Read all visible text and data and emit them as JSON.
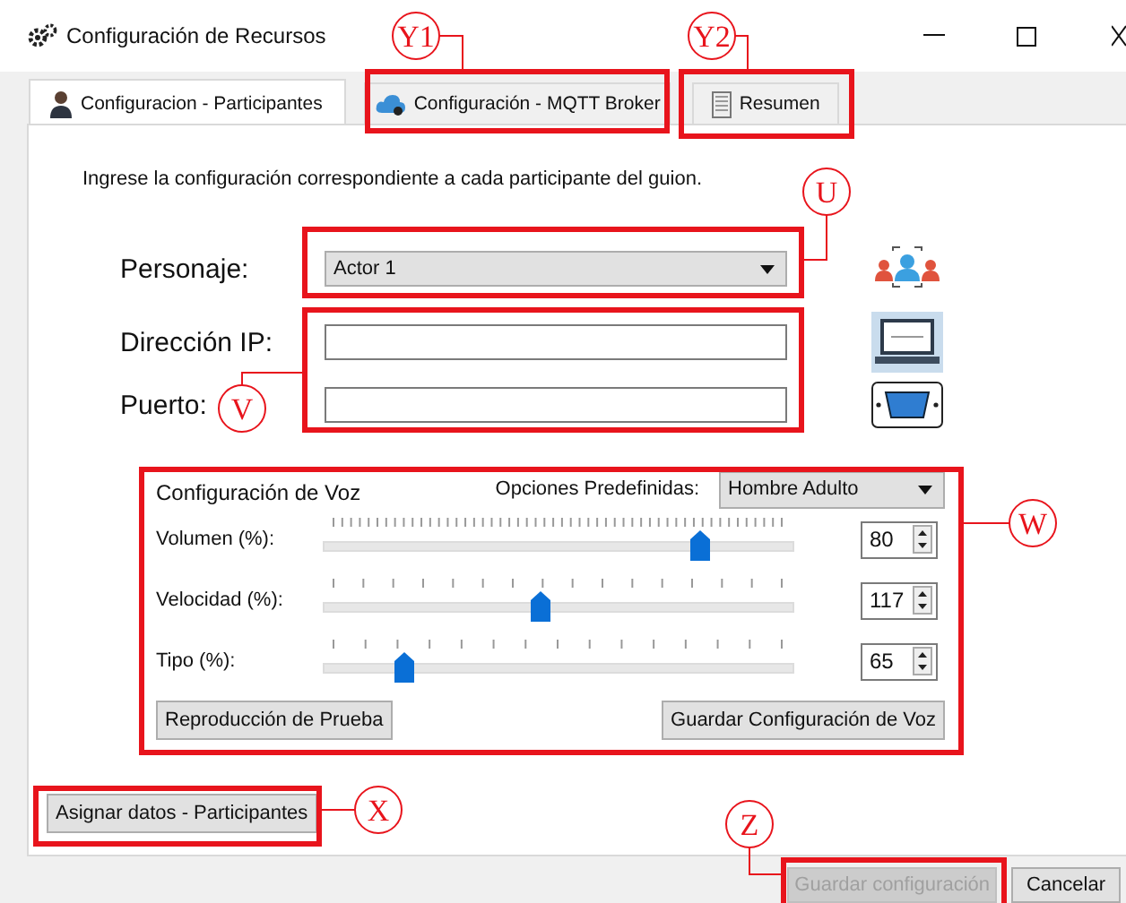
{
  "window": {
    "title": "Configuración de Recursos"
  },
  "tabs": [
    {
      "label": "Configuracion - Participantes",
      "selected": true
    },
    {
      "label": "Configuración - MQTT Broker",
      "selected": false
    },
    {
      "label": "Resumen",
      "selected": false
    }
  ],
  "instructions": "Ingrese la configuración correspondiente a cada participante del guion.",
  "personaje": {
    "label": "Personaje:",
    "value": "Actor 1"
  },
  "ip": {
    "label": "Dirección IP:"
  },
  "puerto": {
    "label": "Puerto:"
  },
  "voice": {
    "title": "Configuración de Voz",
    "presets_label": "Opciones Predefinidas:",
    "preset": "Hombre Adulto",
    "sliders": [
      {
        "label": "Volumen (%):",
        "level": 0.8,
        "value": "80"
      },
      {
        "label": "Velocidad (%):",
        "level": 0.46,
        "value": "117"
      },
      {
        "label": "Tipo (%):",
        "level": 0.17,
        "value": "65"
      }
    ],
    "buttons": [
      "Reproducción de Prueba",
      "Guardar Configuración de Voz"
    ]
  },
  "assign_button": "Asignar datos - Participantes",
  "footer_buttons": [
    {
      "label": "Guardar configuración",
      "disabled": true
    },
    {
      "label": "Cancelar",
      "disabled": false
    }
  ],
  "annotations": [
    "Y1",
    "Y2",
    "U",
    "V",
    "W",
    "X",
    "Z"
  ]
}
